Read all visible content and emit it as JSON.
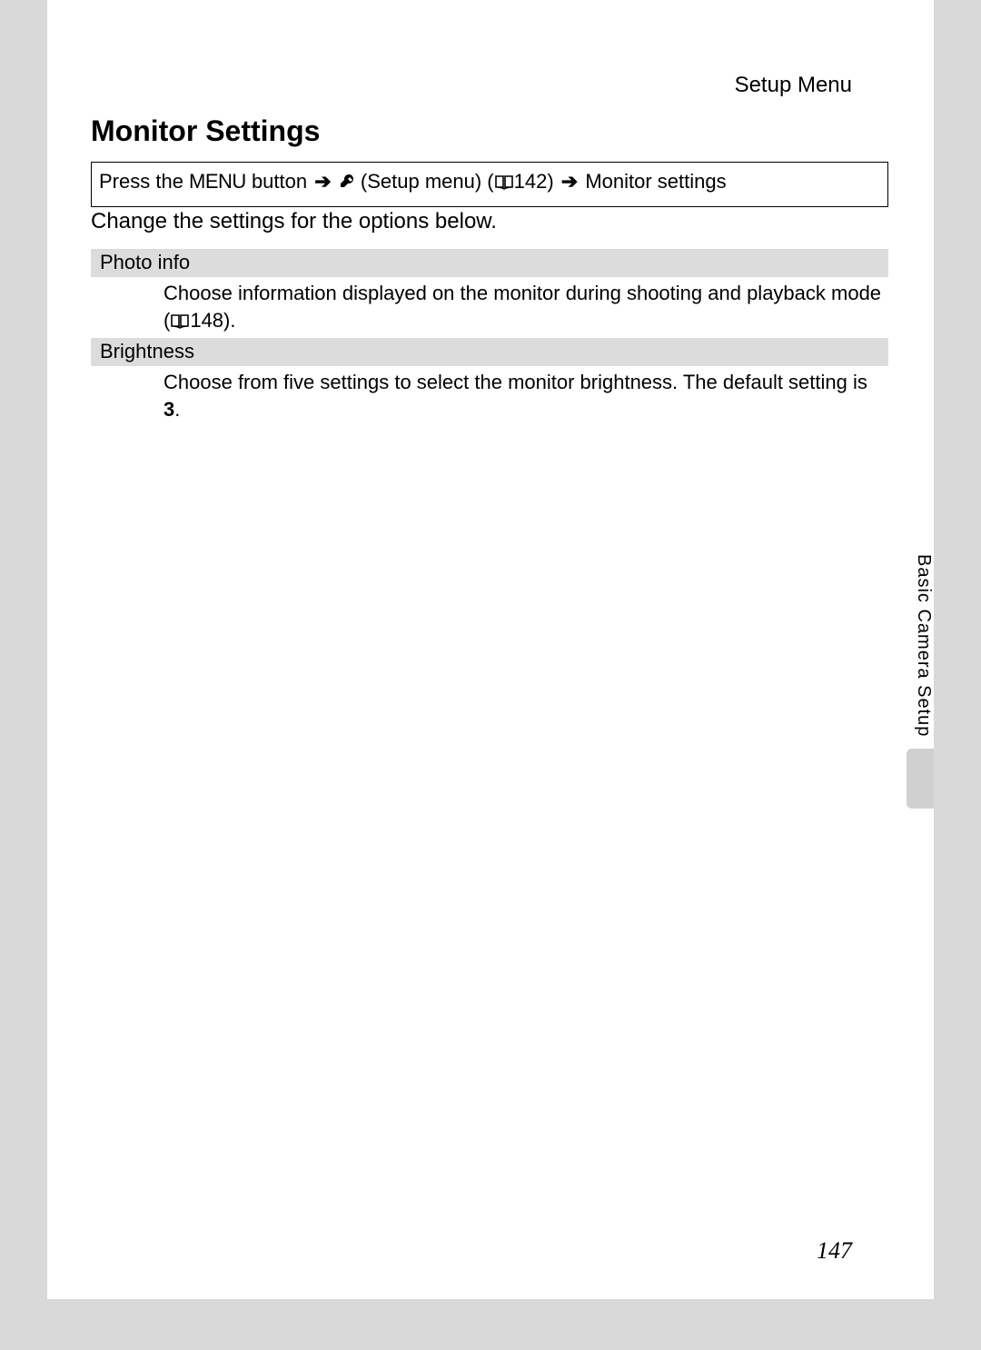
{
  "header": {
    "section": "Setup Menu"
  },
  "title": "Monitor Settings",
  "nav": {
    "press_the": "Press the ",
    "menu_word": "MENU",
    "button_arrow": " button ",
    "setup_menu": " (Setup menu) (",
    "ref1": "142) ",
    "end": " Monitor settings"
  },
  "intro": "Change the settings for the options below.",
  "rows": [
    {
      "head": "Photo info",
      "body_pre": "Choose information displayed on the monitor during shooting and playback mode (",
      "body_ref": "148).",
      "body_post": ""
    },
    {
      "head": "Brightness",
      "body_pre": "Choose from five settings to select the monitor brightness. The default setting is ",
      "body_bold": "3",
      "body_post": "."
    }
  ],
  "side_label": "Basic Camera Setup",
  "page_number": "147"
}
